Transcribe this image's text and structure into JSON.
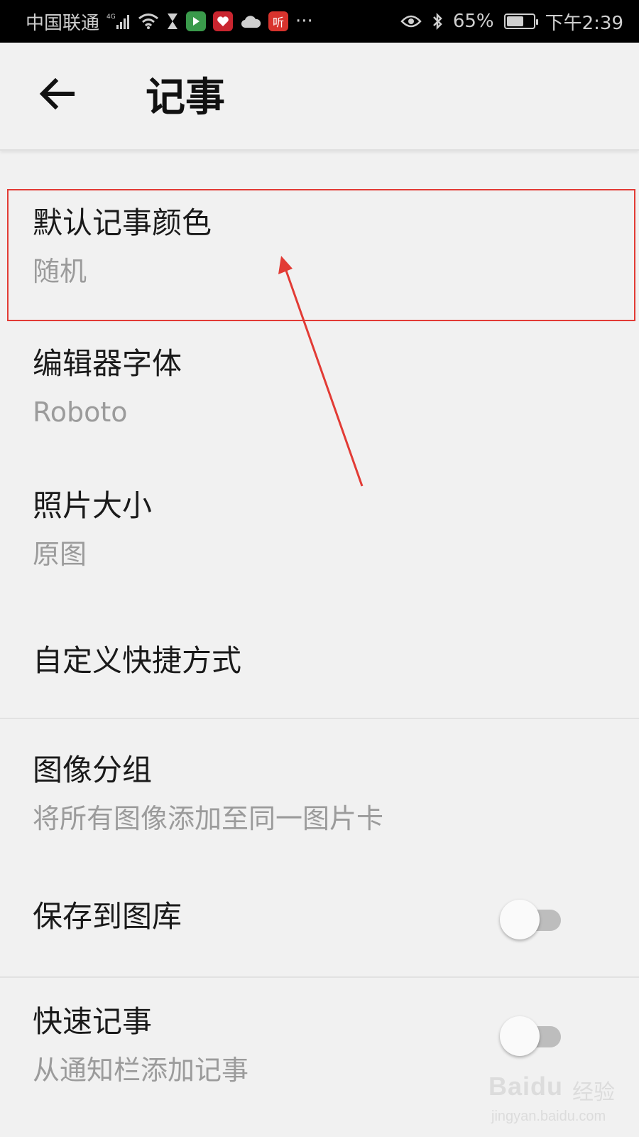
{
  "status_bar": {
    "carrier": "中国联通",
    "network": "4G",
    "battery_percent": "65%",
    "battery_level": 0.65,
    "time": "下午2:39",
    "more": "···",
    "ting_label": "听"
  },
  "toolbar": {
    "back_icon": "arrow-back-icon",
    "title": "记事"
  },
  "settings": [
    {
      "title": "默认记事颜色",
      "subtitle": "随机"
    },
    {
      "title": "编辑器字体",
      "subtitle": "Roboto"
    },
    {
      "title": "照片大小",
      "subtitle": "原图"
    },
    {
      "title": "自定义快捷方式"
    },
    {
      "title": "图像分组",
      "subtitle": "将所有图像添加至同一图片卡"
    },
    {
      "title": "保存到图库",
      "toggle": false
    },
    {
      "title": "快速记事",
      "subtitle": "从通知栏添加记事",
      "toggle": false
    }
  ],
  "annotation": {
    "color": "#e23b35"
  },
  "watermark": {
    "logo": "Baidu",
    "cn": "经验",
    "url": "jingyan.baidu.com"
  }
}
